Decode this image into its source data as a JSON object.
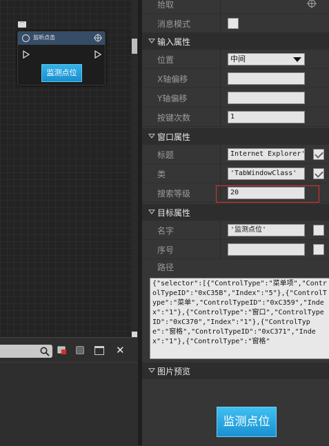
{
  "canvas": {
    "node": {
      "title": "监听点击",
      "button_label": "监测点位"
    }
  },
  "bottom_toolbar": {
    "search_placeholder": ""
  },
  "props": {
    "rows_top": [
      {
        "label": "拾取"
      },
      {
        "label": "消息模式"
      }
    ],
    "input_category": "输入属性",
    "position": {
      "label": "位置",
      "value": "中间"
    },
    "x_offset": {
      "label": "X轴偏移",
      "value": ""
    },
    "y_offset": {
      "label": "Y轴偏移",
      "value": ""
    },
    "click_count": {
      "label": "按键次数",
      "value": "1"
    },
    "window_category": "窗口属性",
    "title_row": {
      "label": "标题",
      "value": "Internet Explorer'",
      "checked": true
    },
    "class_row": {
      "label": "类",
      "value": "'TabWindowClass'",
      "checked": true
    },
    "search_level": {
      "label": "搜索等级",
      "value": "20"
    },
    "target_category": "目标属性",
    "name_row": {
      "label": "名字",
      "value": "'监测点位'",
      "checked": false
    },
    "index_row": {
      "label": "序号",
      "value": "",
      "checked": false
    },
    "path_row": {
      "label": "路径",
      "value": "{\"selector\":[{\"ControlType\":\"菜单项\",\"ControlTypeID\":\"0xC35B\",\"Index\":\"5\"},{\"ControlType\":\"菜单\",\"ControlTypeID\":\"0xC359\",\"Index\":\"1\"},{\"ControlType\":\"窗口\",\"ControlTypeID\":\"0xC370\",\"Index\":\"1\"},{\"ControlType\":\"窗格\",\"ControlTypeID\":\"0xC371\",\"Index\":\"1\"},{\"ControlType\":\"窗格\""
    },
    "preview_category": "图片预览",
    "preview_button": "监测点位"
  }
}
